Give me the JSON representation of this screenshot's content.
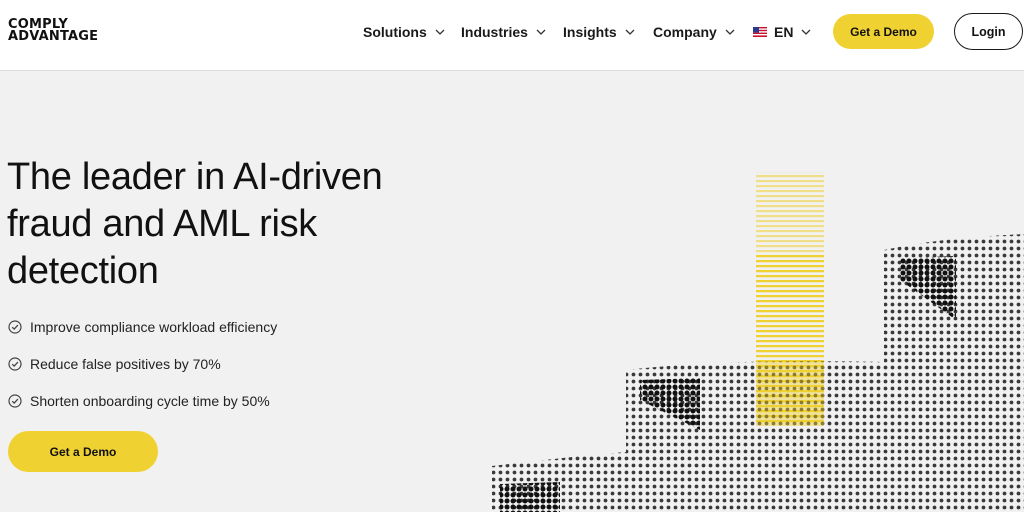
{
  "brand": {
    "logo_line1": "COMPLY",
    "logo_line2": "ADVANTAGE"
  },
  "nav": {
    "items": [
      {
        "label": "Solutions",
        "icon": "chevron-down-icon"
      },
      {
        "label": "Industries",
        "icon": "chevron-down-icon"
      },
      {
        "label": "Insights",
        "icon": "chevron-down-icon"
      },
      {
        "label": "Company",
        "icon": "chevron-down-icon"
      }
    ],
    "language": {
      "label": "EN",
      "flag": "us-flag-icon"
    },
    "demo_label": "Get a Demo",
    "login_label": "Login"
  },
  "hero": {
    "title": "The leader in AI-driven fraud and AML risk detection",
    "benefits": [
      "Improve compliance workload efficiency",
      "Reduce false positives by 70%",
      "Shorten onboarding cycle time by 50%"
    ],
    "cta_label": "Get a Demo"
  },
  "colors": {
    "accent": "#f0d132",
    "background": "#f1f1f1",
    "text": "#111111"
  }
}
